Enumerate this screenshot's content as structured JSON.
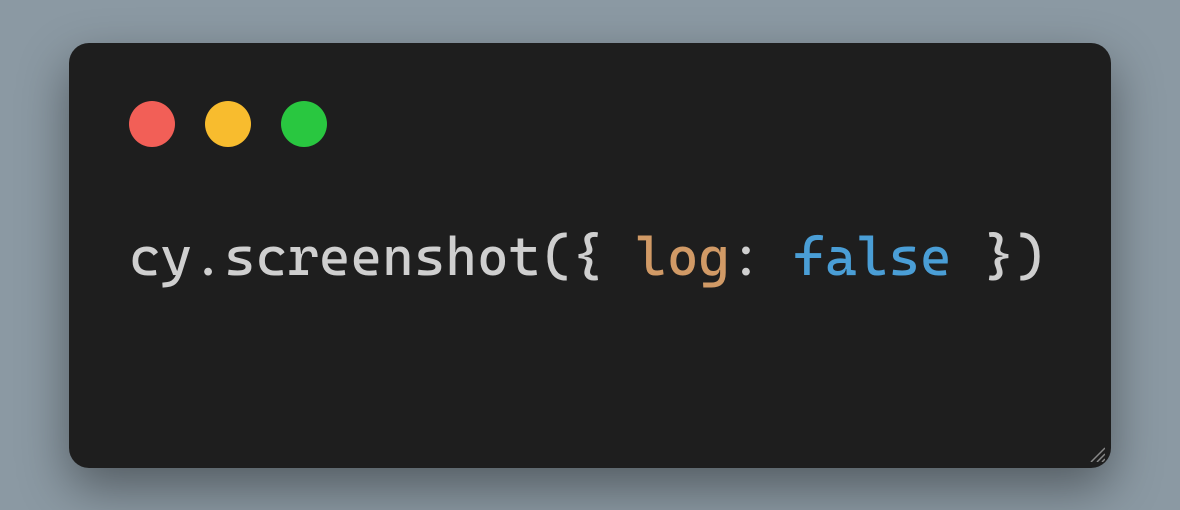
{
  "window": {
    "traffic_lights": {
      "red": "#f25f57",
      "yellow": "#f8bc2e",
      "green": "#29c740"
    }
  },
  "code": {
    "tokens": {
      "t0": "cy",
      "t1": ".",
      "t2": "screenshot",
      "t3": "({ ",
      "t4": "log",
      "t5": ": ",
      "t6": "false",
      "t7": " })"
    }
  }
}
